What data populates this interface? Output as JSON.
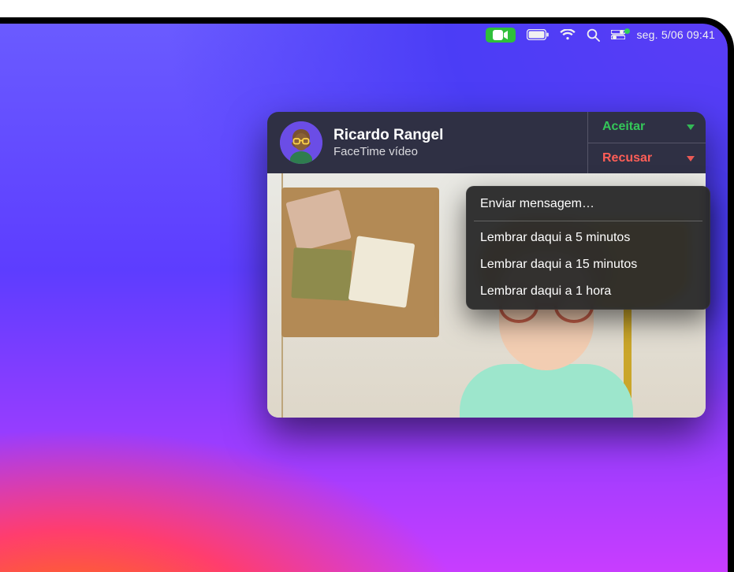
{
  "menubar": {
    "datetime": "seg. 5/06  09:41"
  },
  "notification": {
    "caller_name": "Ricardo Rangel",
    "caller_sub": "FaceTime vídeo",
    "accept_label": "Aceitar",
    "decline_label": "Recusar"
  },
  "decline_menu": {
    "send_message": "Enviar mensagem…",
    "remind_5": "Lembrar daqui a 5 minutos",
    "remind_15": "Lembrar daqui a 15 minutos",
    "remind_1h": "Lembrar daqui a 1 hora"
  }
}
